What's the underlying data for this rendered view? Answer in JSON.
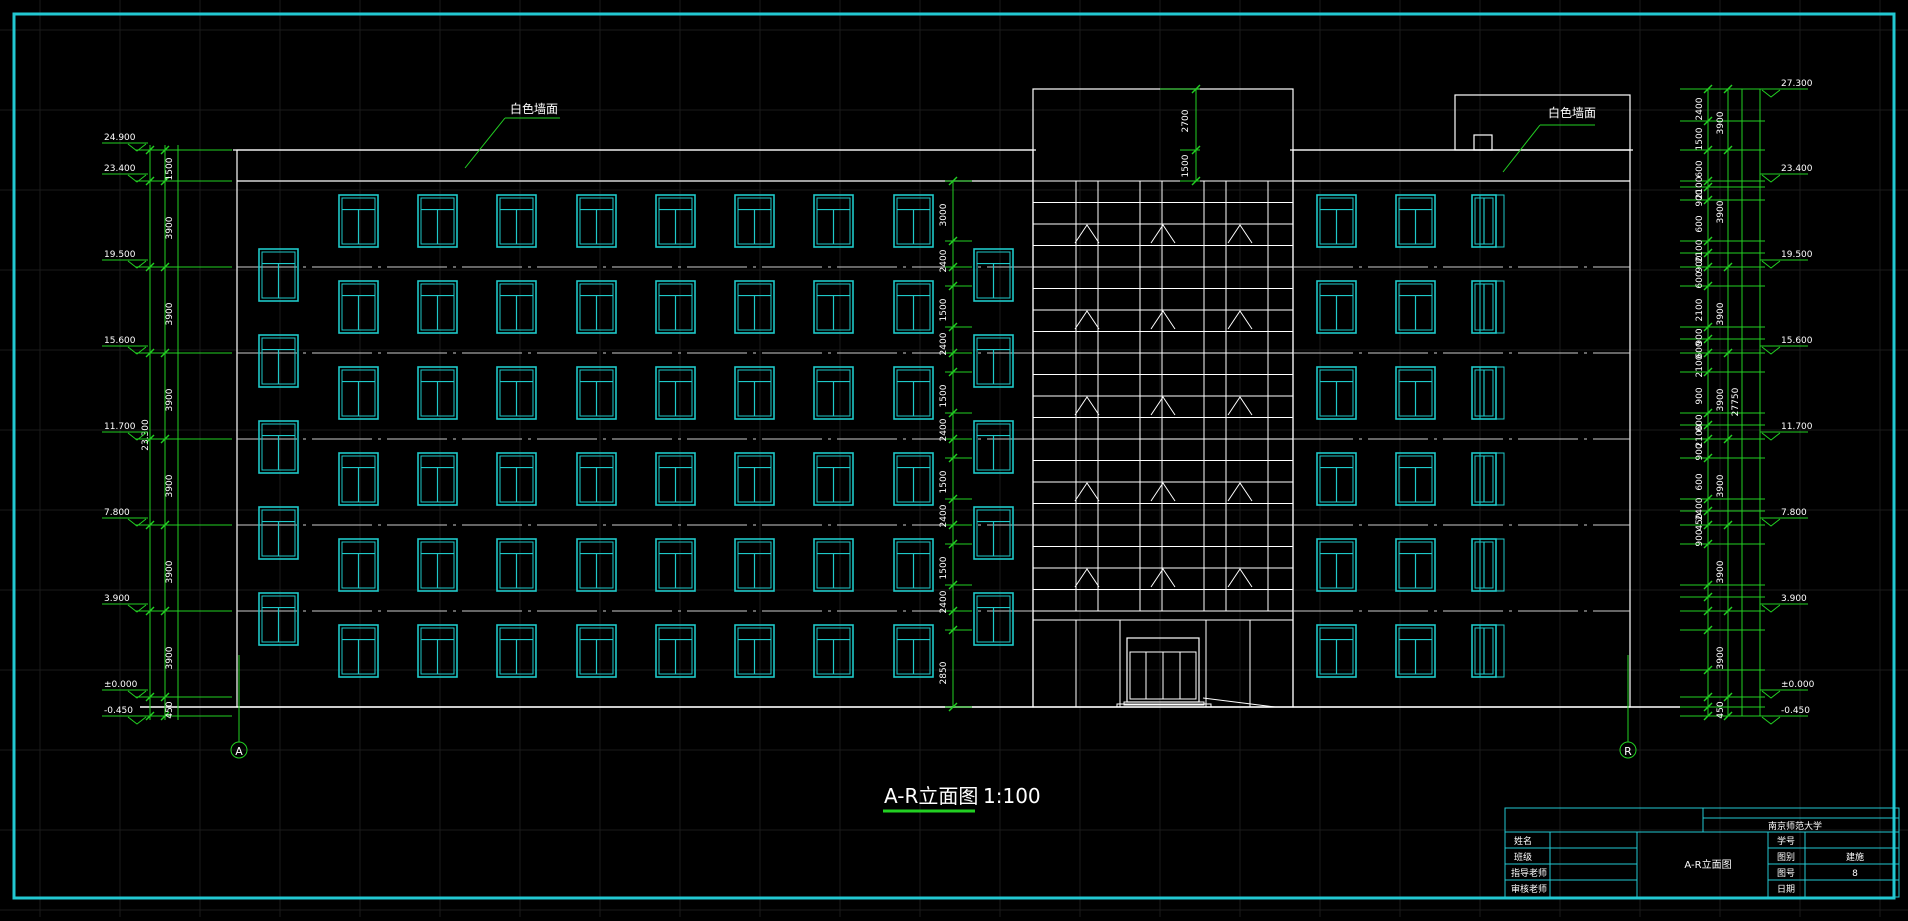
{
  "drawing": {
    "title": "A-R立面图",
    "scale": "1:100",
    "annotation_left": "白色墙面",
    "annotation_right": "白色墙面",
    "axis_left": "A",
    "axis_right": "R"
  },
  "colors": {
    "background": "#000000",
    "frame": "#22c8d2",
    "window": "#1ec8c8",
    "outline": "#ffffff",
    "dimension": "#22d022",
    "grid": "#1a1a1a"
  },
  "levels_left": [
    "24.900",
    "23.400",
    "19.500",
    "15.600",
    "11.700",
    "7.800",
    "3.900",
    "±0.000",
    "-0.450"
  ],
  "levels_right": [
    "27.300",
    "23.400",
    "19.500",
    "15.600",
    "11.700",
    "7.800",
    "3.900",
    "±0.000",
    "-0.450"
  ],
  "dims_left_outer": [
    "1500",
    "3900",
    "3900",
    "3900",
    "3900",
    "3900",
    "3900",
    "450"
  ],
  "dims_left_total": "23.300",
  "dims_mid": [
    "3000",
    "2400",
    "1500",
    "2400",
    "1500",
    "2400",
    "1500",
    "2400",
    "1500",
    "2400",
    "2850"
  ],
  "dims_stair": [
    "2700",
    "1500"
  ],
  "dims_right_inner": [
    "2400",
    "1500",
    "600",
    "2100",
    "900",
    "600",
    "2100",
    "900",
    "600",
    "2100",
    "900",
    "600",
    "2100",
    "900",
    "600",
    "2100",
    "900",
    "600",
    "2400",
    "450",
    "900"
  ],
  "dims_right_outer": [
    "3900",
    "3900",
    "3900",
    "3900",
    "3900",
    "3900",
    "3900",
    "450"
  ],
  "dims_right_total": "27750",
  "title_block": {
    "school": "南京师范大学",
    "labels": [
      "姓名",
      "班级",
      "指导老师",
      "审核老师"
    ],
    "drawing_name": "A-R立面图",
    "right_labels": [
      "学号",
      "图别",
      "图号",
      "日期"
    ],
    "right_values": [
      "",
      "建施",
      "8",
      ""
    ]
  }
}
